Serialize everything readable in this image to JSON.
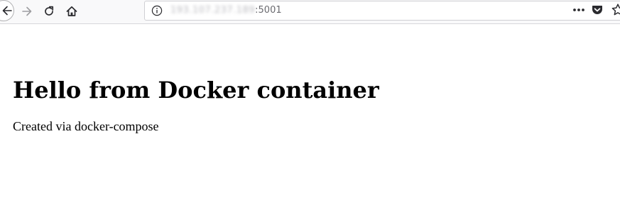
{
  "browser": {
    "toolbar": {
      "back_icon": "arrow-left-icon",
      "forward_icon": "arrow-right-icon",
      "reload_icon": "reload-icon",
      "home_icon": "home-icon"
    },
    "urlbar": {
      "info_icon": "info-icon",
      "host": "193.107.237.189",
      "port_suffix": ":5001"
    },
    "page_actions": {
      "more_icon": "more-icon",
      "pocket_icon": "pocket-icon",
      "bookmark_icon": "star-icon"
    }
  },
  "page": {
    "heading": "Hello from Docker container",
    "paragraph": "Created via docker-compose"
  },
  "colors": {
    "toolbar_bg": "#f9f9fa",
    "icon": "#2a2a2e",
    "icon_disabled": "#9d9da1",
    "page_bg": "#ffffff",
    "text": "#000000"
  }
}
